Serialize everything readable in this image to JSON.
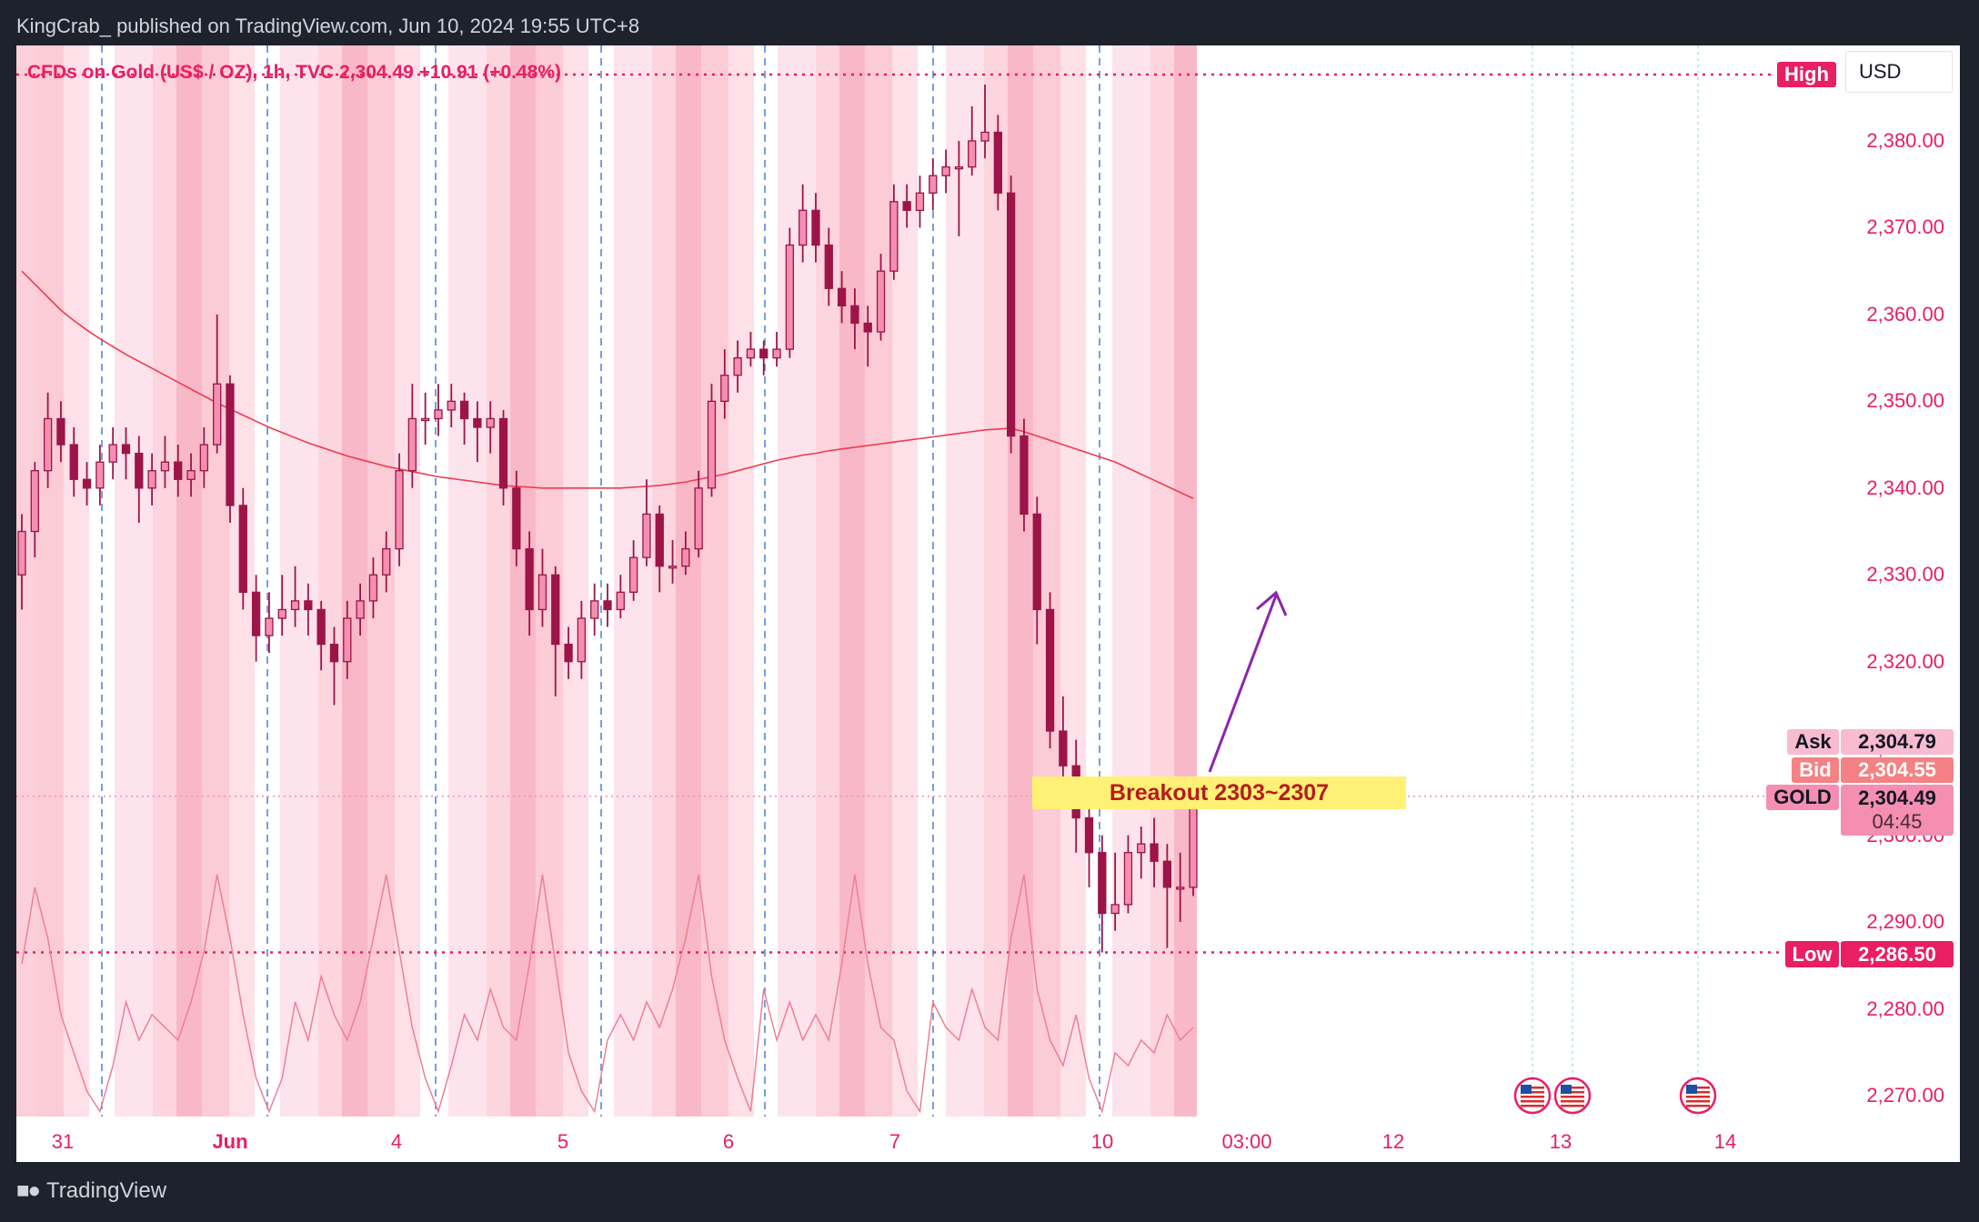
{
  "header": {
    "published": "KingCrab_ published on TradingView.com, Jun 10, 2024 19:55 UTC+8"
  },
  "legend": {
    "text": "CFDs on Gold (US$ / OZ), 1h, TVC 2,304.49 +10.91 (+0.48%)"
  },
  "currency": "USD",
  "annotation": {
    "text": "Breakout 2303~2307",
    "color": "#fff176",
    "arrow_color": "#8e24aa"
  },
  "labels": {
    "high": {
      "label": "High",
      "color": "#e91e63"
    },
    "ask": {
      "label": "Ask",
      "value": "2,304.79",
      "color": "#f8bbd0"
    },
    "bid": {
      "label": "Bid",
      "value": "2,304.55",
      "color": "#f48183"
    },
    "gold": {
      "label": "GOLD",
      "value": "2,304.49",
      "countdown": "04:45",
      "color": "#f48fb1"
    },
    "low": {
      "label": "Low",
      "value": "2,286.50",
      "color": "#e91e63"
    }
  },
  "footer": {
    "brand": "TradingView"
  },
  "chart_data": {
    "type": "candlestick",
    "ylim": [
      2265,
      2392
    ],
    "yticks": [
      "2,380.00",
      "2,370.00",
      "2,360.00",
      "2,350.00",
      "2,340.00",
      "2,330.00",
      "2,320.00",
      "2,310.00",
      "2,300.00",
      "2,290.00",
      "2,280.00",
      "2,270.00"
    ],
    "ytick_values": [
      2380,
      2370,
      2360,
      2350,
      2340,
      2330,
      2320,
      2310,
      2300,
      2290,
      2280,
      2270
    ],
    "xticks": [
      "31",
      "Jun",
      "4",
      "5",
      "6",
      "7",
      "10",
      "03:00",
      "12",
      "13",
      "14"
    ],
    "high_price": 2386.5,
    "low_price": 2286.5,
    "last_price": 2304.49,
    "candles": [
      [
        2330,
        2337,
        2326,
        2335
      ],
      [
        2335,
        2343,
        2332,
        2342
      ],
      [
        2342,
        2351,
        2340,
        2348
      ],
      [
        2348,
        2350,
        2343,
        2345
      ],
      [
        2345,
        2347,
        2339,
        2341
      ],
      [
        2341,
        2343,
        2338,
        2340
      ],
      [
        2340,
        2345,
        2338,
        2343
      ],
      [
        2343,
        2347,
        2341,
        2345
      ],
      [
        2345,
        2347,
        2341,
        2344
      ],
      [
        2344,
        2346,
        2336,
        2340
      ],
      [
        2340,
        2344,
        2338,
        2342
      ],
      [
        2342,
        2346,
        2340,
        2343
      ],
      [
        2343,
        2345,
        2339,
        2341
      ],
      [
        2341,
        2344,
        2339,
        2342
      ],
      [
        2342,
        2347,
        2340,
        2345
      ],
      [
        2345,
        2360,
        2344,
        2352
      ],
      [
        2352,
        2353,
        2336,
        2338
      ],
      [
        2338,
        2340,
        2326,
        2328
      ],
      [
        2328,
        2330,
        2320,
        2323
      ],
      [
        2323,
        2328,
        2321,
        2325
      ],
      [
        2325,
        2330,
        2323,
        2326
      ],
      [
        2326,
        2331,
        2324,
        2327
      ],
      [
        2327,
        2329,
        2323,
        2326
      ],
      [
        2326,
        2327,
        2319,
        2322
      ],
      [
        2322,
        2324,
        2315,
        2320
      ],
      [
        2320,
        2327,
        2318,
        2325
      ],
      [
        2325,
        2329,
        2323,
        2327
      ],
      [
        2327,
        2332,
        2325,
        2330
      ],
      [
        2330,
        2335,
        2328,
        2333
      ],
      [
        2333,
        2344,
        2331,
        2342
      ],
      [
        2342,
        2352,
        2340,
        2348
      ],
      [
        2348,
        2351,
        2345,
        2348
      ],
      [
        2348,
        2352,
        2346,
        2349
      ],
      [
        2349,
        2352,
        2347,
        2350
      ],
      [
        2350,
        2351,
        2345,
        2348
      ],
      [
        2348,
        2350,
        2343,
        2347
      ],
      [
        2347,
        2350,
        2344,
        2348
      ],
      [
        2348,
        2349,
        2338,
        2340
      ],
      [
        2340,
        2342,
        2331,
        2333
      ],
      [
        2333,
        2335,
        2323,
        2326
      ],
      [
        2326,
        2333,
        2324,
        2330
      ],
      [
        2330,
        2331,
        2316,
        2322
      ],
      [
        2322,
        2324,
        2318,
        2320
      ],
      [
        2320,
        2327,
        2318,
        2325
      ],
      [
        2325,
        2329,
        2323,
        2327
      ],
      [
        2327,
        2329,
        2324,
        2326
      ],
      [
        2326,
        2330,
        2325,
        2328
      ],
      [
        2328,
        2334,
        2327,
        2332
      ],
      [
        2332,
        2341,
        2331,
        2337
      ],
      [
        2337,
        2338,
        2328,
        2331
      ],
      [
        2331,
        2334,
        2329,
        2331
      ],
      [
        2331,
        2335,
        2330,
        2333
      ],
      [
        2333,
        2342,
        2332,
        2340
      ],
      [
        2340,
        2352,
        2339,
        2350
      ],
      [
        2350,
        2356,
        2348,
        2353
      ],
      [
        2353,
        2357,
        2351,
        2355
      ],
      [
        2355,
        2358,
        2354,
        2356
      ],
      [
        2356,
        2357,
        2353,
        2355
      ],
      [
        2355,
        2358,
        2354,
        2356
      ],
      [
        2356,
        2370,
        2355,
        2368
      ],
      [
        2368,
        2375,
        2366,
        2372
      ],
      [
        2372,
        2374,
        2366,
        2368
      ],
      [
        2368,
        2370,
        2361,
        2363
      ],
      [
        2363,
        2365,
        2359,
        2361
      ],
      [
        2361,
        2363,
        2356,
        2359
      ],
      [
        2359,
        2361,
        2354,
        2358
      ],
      [
        2358,
        2367,
        2357,
        2365
      ],
      [
        2365,
        2375,
        2364,
        2373
      ],
      [
        2373,
        2375,
        2370,
        2372
      ],
      [
        2372,
        2376,
        2370,
        2374
      ],
      [
        2374,
        2378,
        2372,
        2376
      ],
      [
        2376,
        2379,
        2374,
        2377
      ],
      [
        2377,
        2380,
        2369,
        2377
      ],
      [
        2377,
        2384,
        2376,
        2380
      ],
      [
        2380,
        2386.5,
        2378,
        2381
      ],
      [
        2381,
        2383,
        2372,
        2374
      ],
      [
        2374,
        2376,
        2344,
        2346
      ],
      [
        2346,
        2348,
        2335,
        2337
      ],
      [
        2337,
        2339,
        2322,
        2326
      ],
      [
        2326,
        2328,
        2310,
        2312
      ],
      [
        2312,
        2316,
        2305,
        2308
      ],
      [
        2308,
        2311,
        2298,
        2302
      ],
      [
        2302,
        2304,
        2294,
        2298
      ],
      [
        2298,
        2300,
        2286.5,
        2291
      ],
      [
        2291,
        2298,
        2289,
        2292
      ],
      [
        2292,
        2300,
        2291,
        2298
      ],
      [
        2298,
        2301,
        2295,
        2299
      ],
      [
        2299,
        2302,
        2294,
        2297
      ],
      [
        2297,
        2299,
        2287,
        2294
      ],
      [
        2294,
        2298,
        2290,
        2294
      ],
      [
        2294,
        2306,
        2293,
        2304.49
      ]
    ],
    "moving_average": [
      2365,
      2363.5,
      2362,
      2360.5,
      2359.3,
      2358.2,
      2357.2,
      2356.3,
      2355.4,
      2354.6,
      2353.8,
      2353,
      2352.2,
      2351.4,
      2350.6,
      2349.8,
      2349.1,
      2348.4,
      2347.7,
      2347,
      2346.4,
      2345.8,
      2345.2,
      2344.7,
      2344.2,
      2343.7,
      2343.3,
      2342.9,
      2342.5,
      2342.2,
      2341.9,
      2341.6,
      2341.3,
      2341.1,
      2340.9,
      2340.7,
      2340.5,
      2340.3,
      2340.2,
      2340.1,
      2340,
      2340,
      2340,
      2340,
      2340,
      2340,
      2340,
      2340.1,
      2340.2,
      2340.3,
      2340.5,
      2340.7,
      2341,
      2341.3,
      2341.6,
      2342,
      2342.4,
      2342.8,
      2343.2,
      2343.5,
      2343.8,
      2344,
      2344.3,
      2344.5,
      2344.7,
      2344.9,
      2345.1,
      2345.3,
      2345.5,
      2345.7,
      2345.9,
      2346.1,
      2346.3,
      2346.5,
      2346.7,
      2346.8,
      2346.9,
      2346.5,
      2346,
      2345.5,
      2345,
      2344.5,
      2344,
      2343.5,
      2343,
      2342.3,
      2341.6,
      2340.9,
      2340.2,
      2339.5,
      2338.8
    ],
    "oscillator": [
      60,
      90,
      70,
      40,
      25,
      10,
      2,
      20,
      45,
      30,
      40,
      35,
      30,
      45,
      65,
      95,
      70,
      40,
      15,
      2,
      15,
      45,
      30,
      55,
      40,
      30,
      45,
      70,
      95,
      65,
      35,
      15,
      2,
      20,
      40,
      30,
      50,
      35,
      30,
      60,
      95,
      60,
      25,
      10,
      2,
      30,
      40,
      30,
      45,
      35,
      50,
      70,
      95,
      55,
      30,
      15,
      2,
      50,
      30,
      45,
      30,
      40,
      30,
      60,
      95,
      60,
      35,
      30,
      10,
      2,
      45,
      35,
      30,
      50,
      35,
      30,
      70,
      95,
      50,
      30,
      20,
      40,
      15,
      2,
      25,
      20,
      30,
      25,
      40,
      30,
      35
    ]
  }
}
